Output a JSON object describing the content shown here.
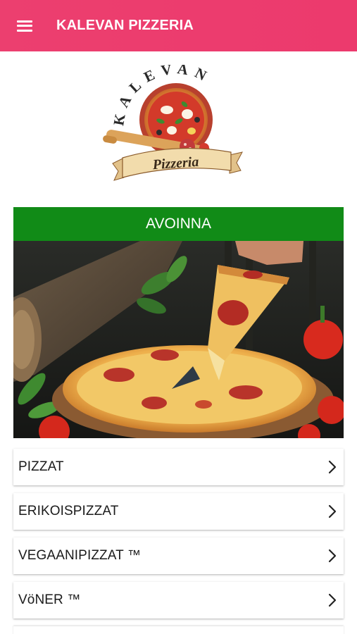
{
  "appbar": {
    "title": "KALEVAN PIZZERIA",
    "menu_icon": "hamburger-menu-icon",
    "background": "#ec3f6f"
  },
  "logo": {
    "arc_text": "KALEVAN",
    "ribbon_text": "Pizzeria"
  },
  "status": {
    "label": "AVOINNA",
    "color": "#118b17"
  },
  "menu": {
    "items": [
      {
        "label": "PIZZAT"
      },
      {
        "label": "ERIKOISPIZZAT"
      },
      {
        "label": "VEGAANIPIZZAT ™"
      },
      {
        "label": "VöNER ™"
      }
    ],
    "chevron_icon": "chevron-right-icon"
  }
}
